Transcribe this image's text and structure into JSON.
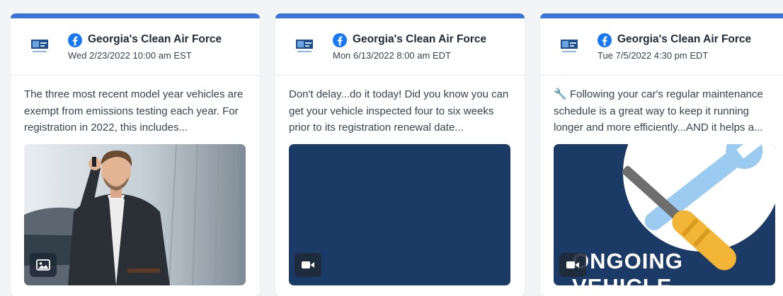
{
  "accent_color": "#3b74d9",
  "posts": [
    {
      "page_name": "Georgia's Clean Air Force",
      "timestamp": "Wed 2/23/2022 10:00 am EST",
      "text": "The three most recent model year vehicles are exempt from emissions testing each year. For registration in 2022, this includes...",
      "media_type": "image-icon"
    },
    {
      "page_name": "Georgia's Clean Air Force",
      "timestamp": "Mon 6/13/2022 8:00 am EDT",
      "text": "Don't delay...do it today! Did you know you can get your vehicle inspected four to six weeks prior to its registration renewal date...",
      "media_type": "video-icon"
    },
    {
      "page_name": "Georgia's Clean Air Force",
      "timestamp": "Tue 7/5/2022 4:30 pm EDT",
      "text": "🔧 Following your car's regular maintenance schedule is a great way to keep it running longer and more efficiently...AND it helps a...",
      "media_type": "video-icon",
      "media_overlay_line1": "ONGOING",
      "media_overlay_line2": "VEHICLE"
    }
  ]
}
